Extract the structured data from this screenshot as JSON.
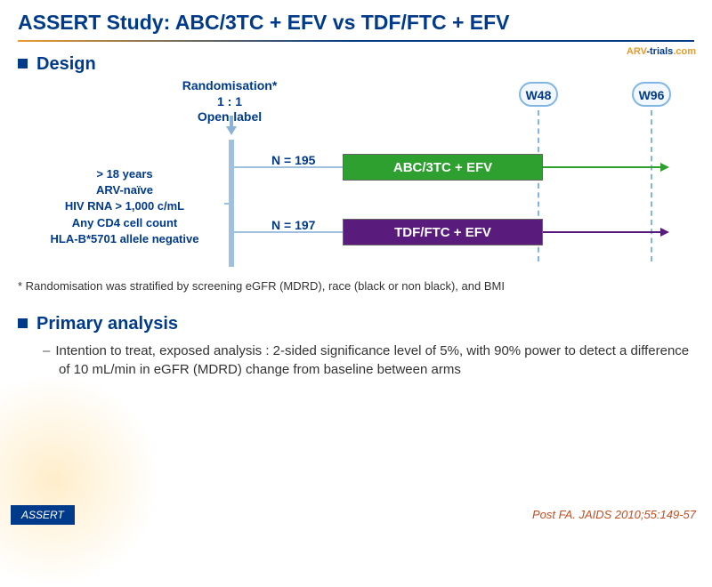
{
  "title": "ASSERT Study: ABC/3TC + EFV vs TDF/FTC + EFV",
  "logo": {
    "text1": "ARV",
    "text2": "-trials",
    "text3": ".com"
  },
  "design": {
    "heading": "Design",
    "randomisation": {
      "line1": "Randomisation*",
      "line2": "1 : 1",
      "line3": "Open-label"
    },
    "criteria": {
      "line1": "> 18 years",
      "line2": "ARV-naïve",
      "line3": "HIV RNA > 1,000 c/mL",
      "line4": "Any CD4 cell count",
      "line5": "HLA-B*5701 allele negative"
    },
    "arm1": {
      "n": "N = 195",
      "label": "ABC/3TC + EFV"
    },
    "arm2": {
      "n": "N = 197",
      "label": "TDF/FTC + EFV"
    },
    "w48": "W48",
    "w96": "W96"
  },
  "footnote": "* Randomisation was stratified by screening eGFR (MDRD), race (black or non black), and BMI",
  "primary": {
    "heading": "Primary analysis",
    "bullet": "Intention to treat, exposed analysis : 2-sided significance level of 5%, with 90% power to detect a difference of 10 mL/min in eGFR (MDRD) change from baseline between arms"
  },
  "footer_tag": "ASSERT",
  "citation": "Post FA. JAIDS 2010;55:149-57"
}
